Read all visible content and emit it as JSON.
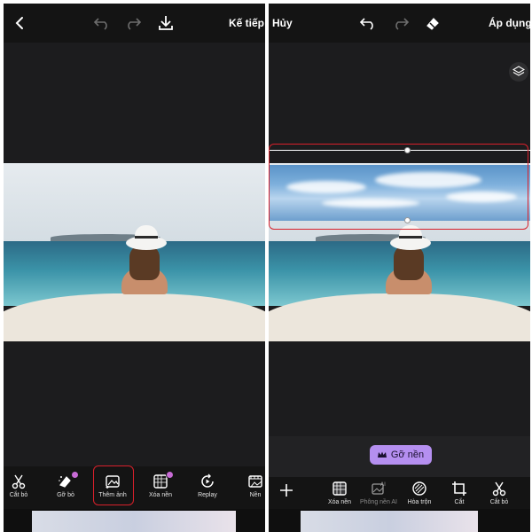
{
  "left": {
    "topbar": {
      "next_label": "Kế tiếp"
    },
    "tools": [
      {
        "label": "Cắt bỏ",
        "icon": "scissors-icon"
      },
      {
        "label": "Gỡ bỏ",
        "icon": "eraser-icon",
        "badge": true
      },
      {
        "label": "Thêm ảnh",
        "icon": "add-image-icon"
      },
      {
        "label": "Xóa nền",
        "icon": "remove-background-icon",
        "badge": true
      },
      {
        "label": "Replay",
        "icon": "replay-icon"
      },
      {
        "label": "Nền",
        "icon": "background-icon"
      }
    ]
  },
  "right": {
    "topbar": {
      "cancel_label": "Hủy",
      "apply_label": "Áp dụng"
    },
    "remove_bg_button": {
      "label": "Gỡ nền",
      "icon": "crown-icon"
    },
    "tools": [
      {
        "label": "",
        "icon": "plus-icon"
      },
      {
        "label": "Xóa nền",
        "icon": "remove-background-icon"
      },
      {
        "label": "Phông nền AI",
        "icon": "ai-background-icon",
        "dim": true
      },
      {
        "label": "Hòa trộn",
        "icon": "blend-icon"
      },
      {
        "label": "Cắt",
        "icon": "crop-icon"
      },
      {
        "label": "Cắt bỏ",
        "icon": "scissors-icon"
      }
    ]
  },
  "colors": {
    "highlight": "#d9202b",
    "accent_purple": "#b58ff0",
    "badge": "#c86bd6",
    "background": "#1c1c1e"
  }
}
